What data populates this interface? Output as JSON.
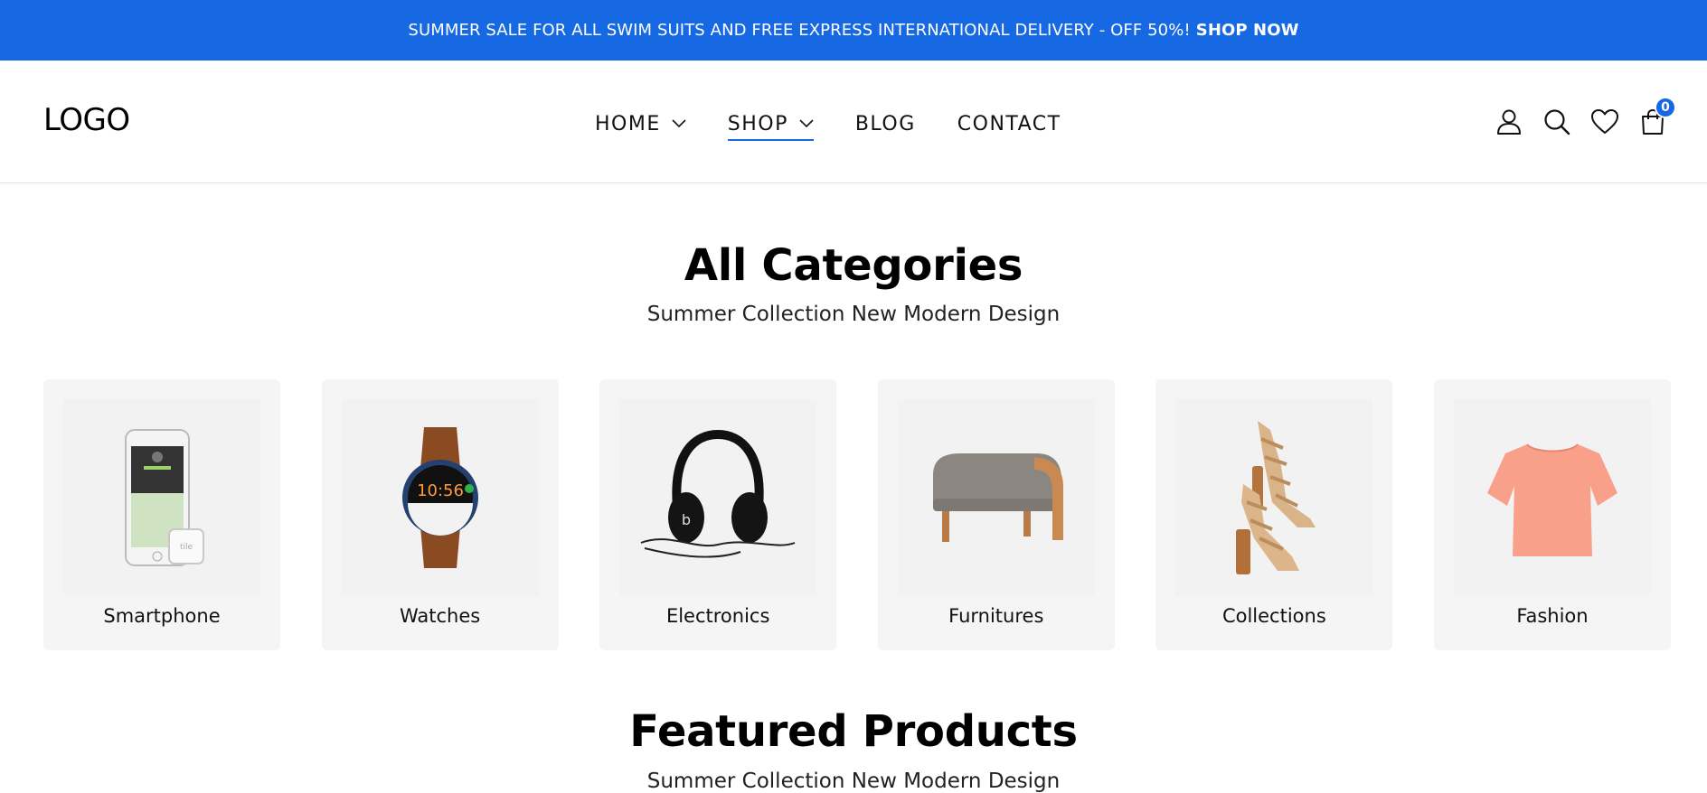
{
  "announcement": {
    "text": "SUMMER SALE FOR ALL SWIM SUITS AND FREE EXPRESS INTERNATIONAL DELIVERY - OFF 50%!",
    "cta": "SHOP NOW"
  },
  "header": {
    "logo": "LOGO",
    "nav": [
      {
        "label": "HOME",
        "dropdown": true,
        "active": false
      },
      {
        "label": "SHOP",
        "dropdown": true,
        "active": true
      },
      {
        "label": "BLOG",
        "dropdown": false,
        "active": false
      },
      {
        "label": "CONTACT",
        "dropdown": false,
        "active": false
      }
    ],
    "icons": [
      "user-icon",
      "search-icon",
      "heart-icon",
      "bag-icon"
    ],
    "cart_count": "0"
  },
  "categories": {
    "title": "All Categories",
    "subtitle": "Summer Collection New Modern Design",
    "items": [
      {
        "label": "Smartphone",
        "icon": "smartphone-image"
      },
      {
        "label": "Watches",
        "icon": "watch-image"
      },
      {
        "label": "Electronics",
        "icon": "headphones-image"
      },
      {
        "label": "Furnitures",
        "icon": "ottoman-image"
      },
      {
        "label": "Collections",
        "icon": "sandals-image"
      },
      {
        "label": "Fashion",
        "icon": "tshirt-image"
      }
    ]
  },
  "featured": {
    "title": "Featured Products",
    "subtitle": "Summer Collection New Modern Design"
  },
  "colors": {
    "accent": "#1668e3",
    "card_bg": "#f5f5f5"
  }
}
